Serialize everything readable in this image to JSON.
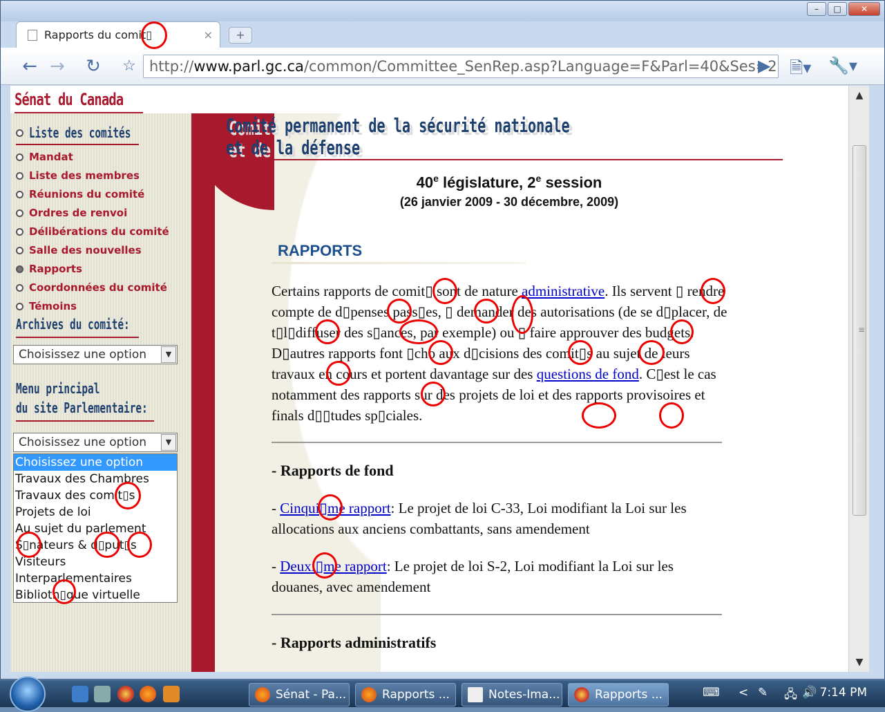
{
  "browser": {
    "tab_title": "Rapports du comit▯",
    "tab_close": "×",
    "new_tab": "+",
    "url_prefix": "http://",
    "url_host": "www.parl.gc.ca",
    "url_path": "/common/Committee_SenRep.asp?Language=F&Parl=40&Ses=2&",
    "window_buttons": [
      "–",
      "□",
      "✕"
    ]
  },
  "site": {
    "name": "Sénat du Canada"
  },
  "sidebar": {
    "lead_item": "Liste des comités",
    "items": [
      {
        "label": "Mandat"
      },
      {
        "label": "Liste des membres"
      },
      {
        "label": "Réunions du comité"
      },
      {
        "label": "Ordres de renvoi"
      },
      {
        "label": "Délibérations du comité"
      },
      {
        "label": "Salle des nouvelles"
      },
      {
        "label": "Rapports",
        "current": true
      },
      {
        "label": "Coordonnées du comité"
      },
      {
        "label": "Témoins"
      }
    ],
    "archives_heading": "Archives du comité:",
    "archives_select": "Choisissez une option",
    "menu_heading_line1": "Menu principal",
    "menu_heading_line2": "du site Parlementaire:",
    "menu_select": "Choisissez une option",
    "menu_options": [
      "Choisissez une option",
      "Travaux des Chambres",
      "Travaux des comit▯s",
      "Projets de loi",
      "Au sujet du parlement",
      "S▯nateurs & d▯put▯s",
      "Visiteurs",
      "Interparlementaires",
      "Biblioth▯que virtuelle"
    ]
  },
  "main": {
    "title_line1": "Comité permanent de la sécurité nationale",
    "title_line2": "et de la défense",
    "legislature_num": "40",
    "legislature_sup": "e",
    "legislature_text": " législature, 2",
    "session_sup": "e",
    "session_text": " session",
    "dates": "(26 janvier 2009 - 30 décembre, 2009)",
    "section": "RAPPORTS",
    "para_1": "Certains rapports de comit▯ sont de nature ",
    "para_link_1": "administrative",
    "para_2": ". Ils servent ▯ rendre compte de d▯penses pass▯es, ▯ demander des autorisations (de se d▯placer, de t▯l▯diffuser des s▯ances, par exemple) ou ▯ faire approuver des budgets. D▯autres rapports font ▯cho aux d▯cisions des comit▯s au sujet de leurs travaux en cours et portent davantage sur des ",
    "para_link_2": "questions de fond",
    "para_3": ". C▯est le cas notamment des rapports sur des projets de loi et des rapports provisoires et finals d▯▯tudes sp▯ciales.",
    "sub_fond": "- Rapports de fond",
    "reports": [
      {
        "dash": "- ",
        "link": "Cinqui▯me rapport",
        "text": ": Le projet de loi C-33, Loi modifiant la Loi sur les allocations aux anciens combattants, sans amendement"
      },
      {
        "dash": "- ",
        "link": "Deuxi▯me rapport",
        "text": ": Le projet de loi S-2, Loi modifiant la Loi sur les douanes, avec amendement"
      }
    ],
    "sub_admin": "- Rapports administratifs"
  },
  "taskbar": {
    "tasks": [
      "Sénat - Pa...",
      "Rapports ...",
      "Notes-Ima...",
      "Rapports ..."
    ],
    "clock": "7:14 PM",
    "tray_chevron": "<"
  },
  "colors": {
    "senate_red": "#a8192e",
    "title_blue": "#1d3f6e",
    "link": "#0000cc",
    "annotation": "#ee0000"
  }
}
